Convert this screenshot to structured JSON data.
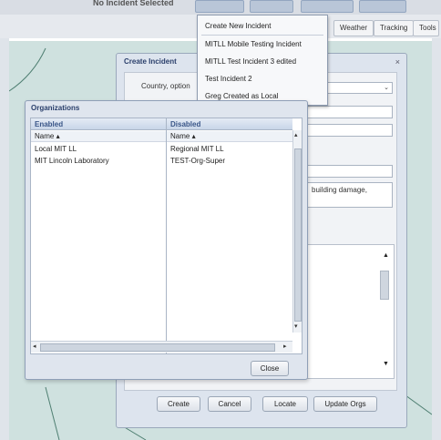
{
  "topbar": {
    "no_incident": "No Incident Selected"
  },
  "toolbar": {
    "weather": "Weather",
    "tracking": "Tracking",
    "tools": "Tools"
  },
  "incident_menu": {
    "items": [
      "Create New Incident",
      "MITLL Mobile Testing Incident",
      "MITLL Test Incident 3 edited",
      "Test Incident 2",
      "Greg Created as Local"
    ]
  },
  "create_incident": {
    "title": "Create Incident",
    "country_label": "Country, option",
    "description_snippet": "building damage,",
    "buttons": {
      "create": "Create",
      "cancel": "Cancel",
      "locate": "Locate",
      "update_orgs": "Update Orgs"
    }
  },
  "organizations": {
    "title": "Organizations",
    "enabled": {
      "header": "Enabled",
      "column": "Name ▴",
      "rows": [
        "Local MIT LL",
        "MIT Lincoln Laboratory"
      ]
    },
    "disabled": {
      "header": "Disabled",
      "column": "Name ▴",
      "rows": [
        "Regional MIT LL",
        "TEST-Org-Super"
      ]
    },
    "close_label": "Close"
  }
}
